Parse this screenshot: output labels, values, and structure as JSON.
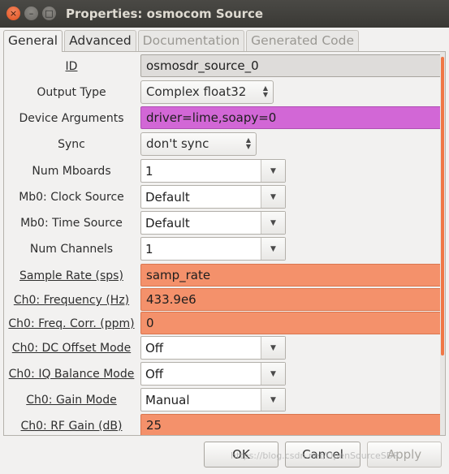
{
  "window": {
    "title": "Properties: osmocom Source",
    "close_glyph": "×",
    "min_glyph": "–",
    "max_glyph": "□"
  },
  "tabs": [
    "General",
    "Advanced",
    "Documentation",
    "Generated Code"
  ],
  "active_tab": "General",
  "fields": {
    "id": {
      "label": "ID",
      "value": "osmosdr_source_0"
    },
    "output_type": {
      "label": "Output Type",
      "value": "Complex float32"
    },
    "device_args": {
      "label": "Device Arguments",
      "value": "driver=lime,soapy=0"
    },
    "sync": {
      "label": "Sync",
      "value": "don't sync"
    },
    "num_mboards": {
      "label": "Num Mboards",
      "value": "1"
    },
    "clock_source": {
      "label": "Mb0: Clock Source",
      "value": "Default"
    },
    "time_source": {
      "label": "Mb0: Time Source",
      "value": "Default"
    },
    "num_channels": {
      "label": "Num Channels",
      "value": "1"
    },
    "sample_rate": {
      "label": "Sample Rate (sps)",
      "value": "samp_rate"
    },
    "frequency": {
      "label": "Ch0: Frequency (Hz)",
      "value": "433.9e6"
    },
    "freq_corr": {
      "label": "Ch0: Freq. Corr. (ppm)",
      "value": "0"
    },
    "dc_offset": {
      "label": "Ch0: DC Offset Mode",
      "value": "Off"
    },
    "iq_balance": {
      "label": "Ch0: IQ Balance Mode",
      "value": "Off"
    },
    "gain_mode": {
      "label": "Ch0: Gain Mode",
      "value": "Manual"
    },
    "rf_gain": {
      "label": "Ch0: RF Gain (dB)",
      "value": "25"
    }
  },
  "buttons": {
    "ok": "OK",
    "cancel": "Cancel",
    "apply": "Apply"
  },
  "watermark": "https://blog.csdn.net/OpenSourceSDR",
  "colors": {
    "param_error": "#f4916b",
    "param_warning": "#d267d6",
    "scroll_accent": "#f07746"
  }
}
